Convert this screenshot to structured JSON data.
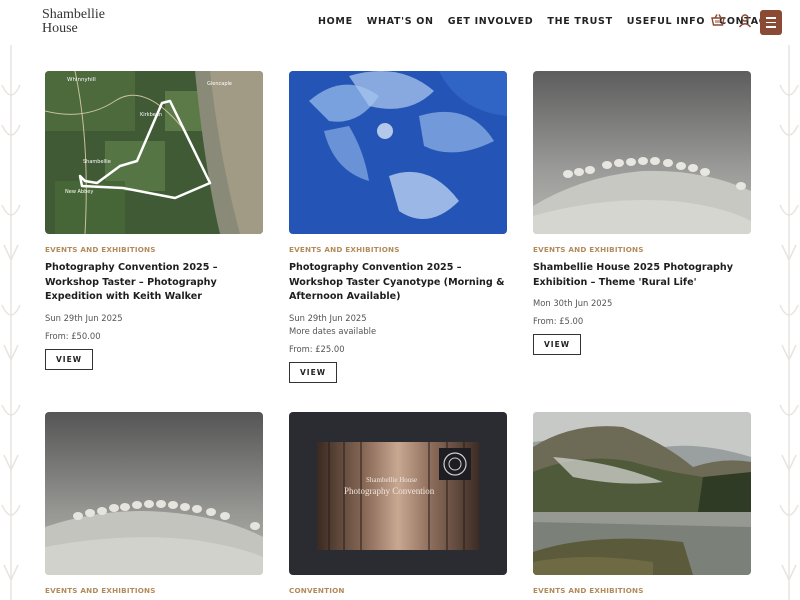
{
  "brand": {
    "line1": "Shambellie",
    "line2": "House"
  },
  "nav": {
    "items": [
      "HOME",
      "WHAT'S ON",
      "GET INVOLVED",
      "THE TRUST",
      "USEFUL INFO",
      "CONTACT"
    ]
  },
  "header_icons": [
    "basket-icon",
    "user-icon",
    "hamburger-menu-icon"
  ],
  "colors": {
    "accent": "#8a4a33",
    "category": "#b38a5a"
  },
  "cards": [
    {
      "category": "EVENTS AND EXHIBITIONS",
      "title": "Photography Convention 2025 – Workshop Taster – Photography Expedition with Keith Walker",
      "date": "Sun 29th Jun 2025",
      "more": "",
      "price": "From: £50.00",
      "button": "VIEW",
      "map_labels": [
        "Whinnyhill",
        "Kirkbean",
        "Glencaple",
        "Shambellie",
        "New Abbey"
      ]
    },
    {
      "category": "EVENTS AND EXHIBITIONS",
      "title": "Photography Convention 2025 – Workshop Taster Cyanotype (Morning & Afternoon Available)",
      "date": "Sun 29th Jun 2025",
      "more": "More dates available",
      "price": "From: £25.00",
      "button": "VIEW"
    },
    {
      "category": "EVENTS AND EXHIBITIONS",
      "title": "Shambellie House 2025 Photography Exhibition – Theme 'Rural Life'",
      "date": "Mon 30th Jun 2025",
      "more": "",
      "price": "From: £5.00",
      "button": "VIEW"
    },
    {
      "category": "EVENTS AND EXHIBITIONS"
    },
    {
      "category": "CONVENTION",
      "poster_line1": "Shambellie House",
      "poster_line2": "Photography Convention"
    },
    {
      "category": "EVENTS AND EXHIBITIONS"
    }
  ]
}
